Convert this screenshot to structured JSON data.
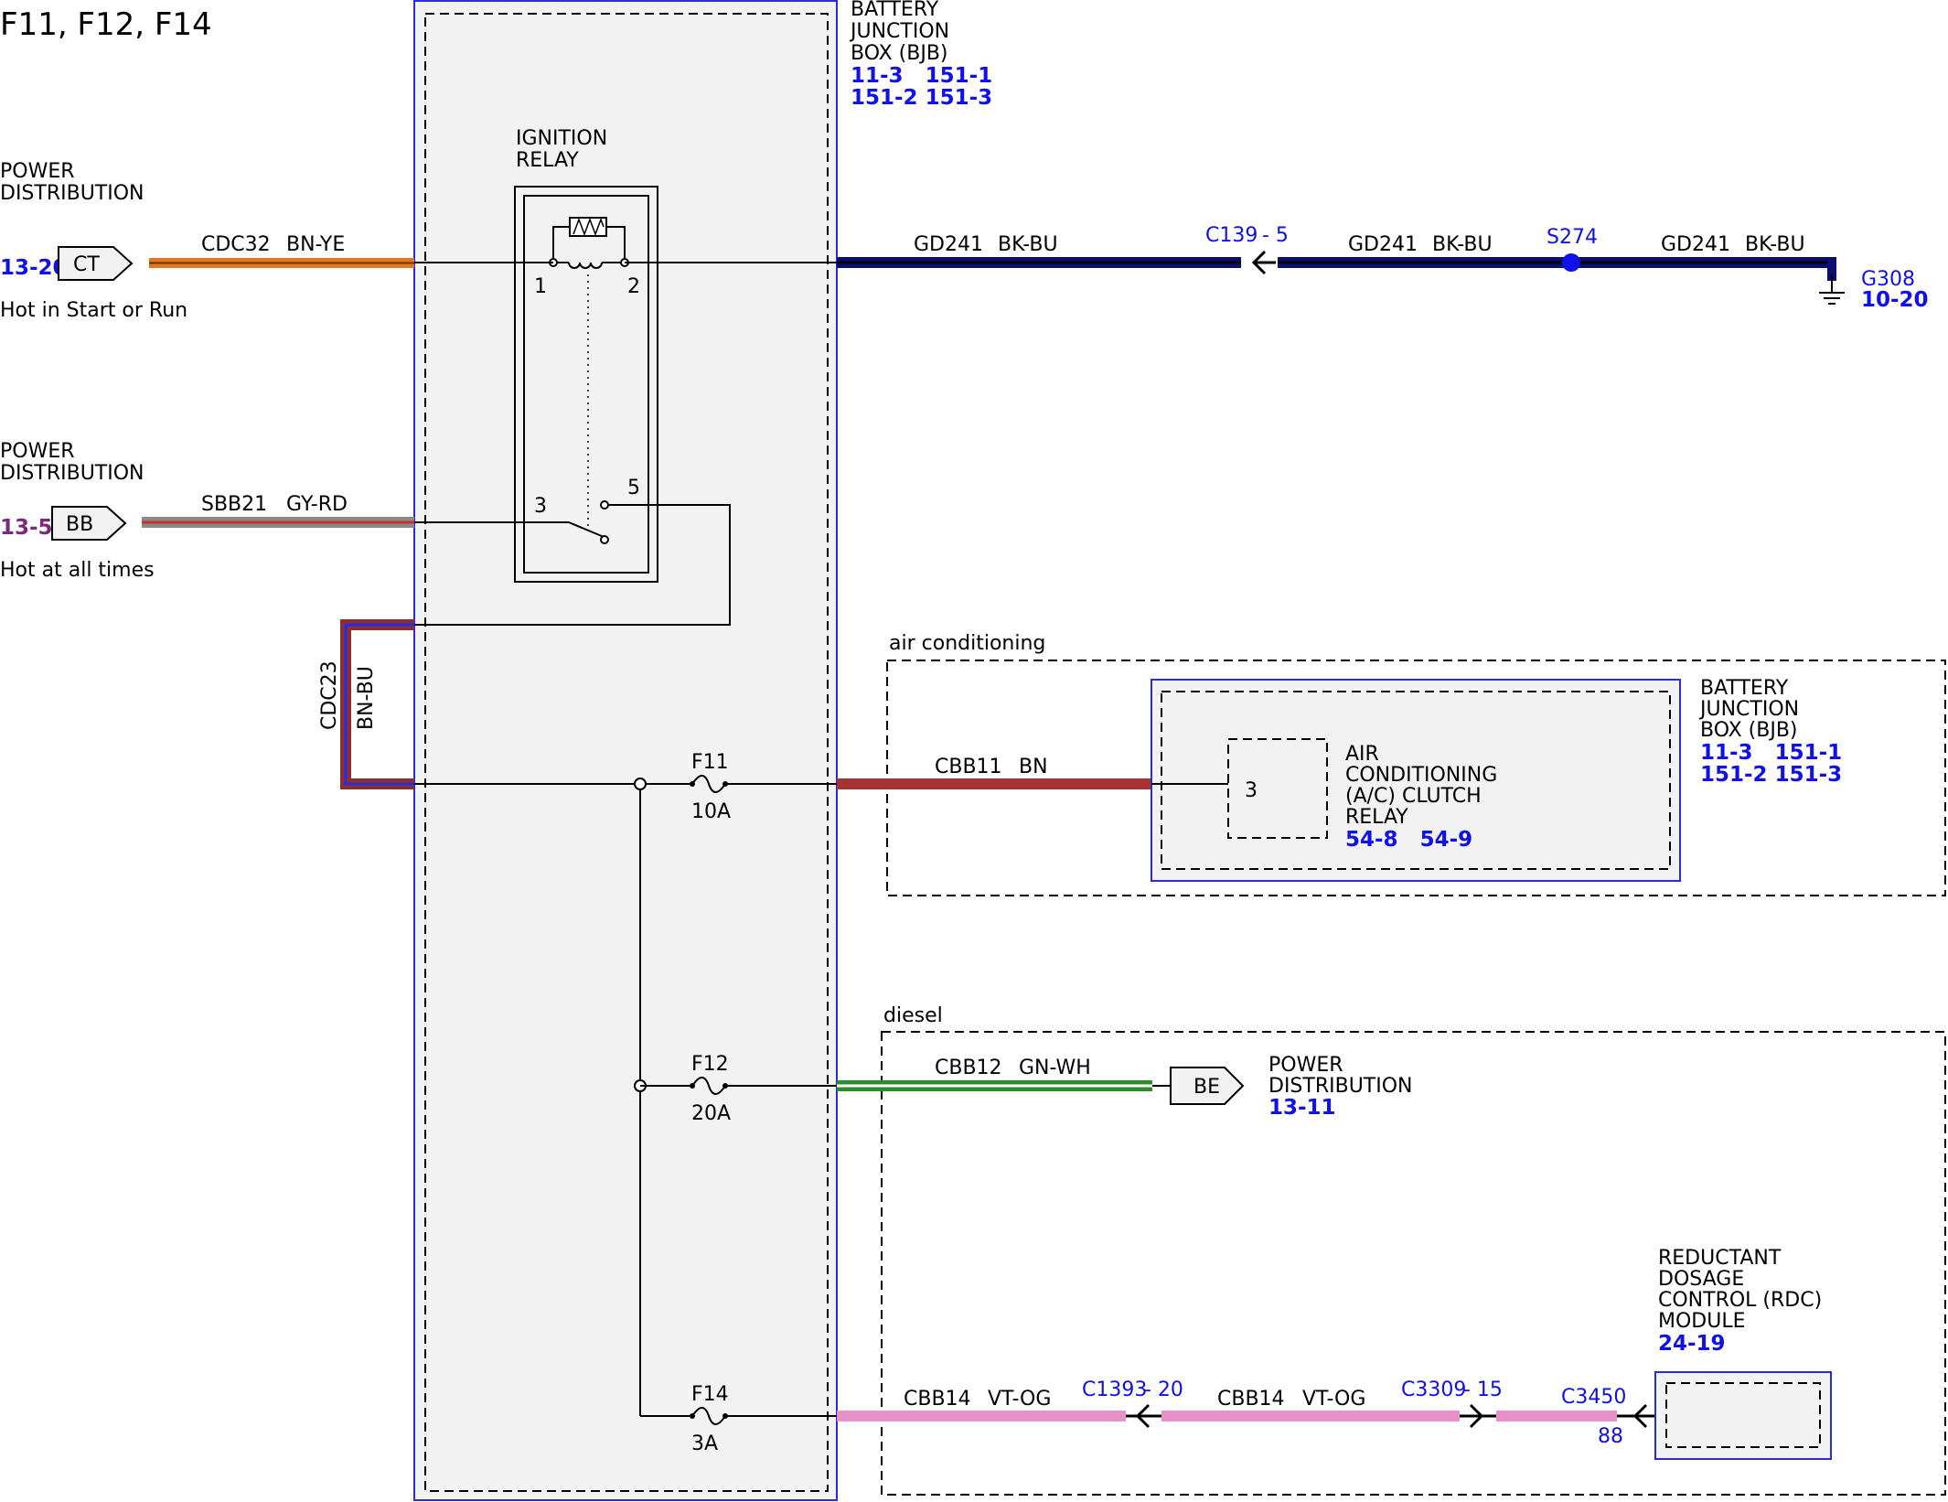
{
  "title": "F11, F12, F14",
  "bjb_main": {
    "name_lines": [
      "BATTERY",
      "JUNCTION",
      "BOX (BJB)"
    ],
    "ref_line1": "11-3   151-1",
    "ref_line2": "151-2 151-3"
  },
  "ignition_relay": {
    "label_lines": [
      "IGNITION",
      "RELAY"
    ],
    "pins": [
      "1",
      "2",
      "3",
      "5"
    ]
  },
  "inputs": [
    {
      "source_lines": [
        "POWER",
        "DISTRIBUTION"
      ],
      "ref": "13-20",
      "connector": "CT",
      "circuit": "CDC32",
      "color": "BN-YE",
      "note": "Hot in Start or Run"
    },
    {
      "source_lines": [
        "POWER",
        "DISTRIBUTION"
      ],
      "ref": "13-5",
      "connector": "BB",
      "circuit": "SBB21",
      "color": "GY-RD",
      "note": "Hot at all times"
    }
  ],
  "jumper": {
    "circuit": "CDC23",
    "color": "BN-BU"
  },
  "ground_path": {
    "seg1": {
      "circuit": "GD241",
      "color": "BK-BU"
    },
    "c139": {
      "name": "C139",
      "pin": "- 5"
    },
    "seg2": {
      "circuit": "GD241",
      "color": "BK-BU"
    },
    "splice": "S274",
    "seg3": {
      "circuit": "GD241",
      "color": "BK-BU"
    },
    "ground": "G308",
    "ground_ref": "10-20"
  },
  "fuses": [
    {
      "name": "F11",
      "rating": "10A"
    },
    {
      "name": "F12",
      "rating": "20A"
    },
    {
      "name": "F14",
      "rating": "3A"
    }
  ],
  "ac_option": {
    "label": "air conditioning",
    "wire": {
      "circuit": "CBB11",
      "color": "BN"
    },
    "pin": "3",
    "relay_lines": [
      "AIR",
      "CONDITIONING",
      "(A/C) CLUTCH",
      "RELAY"
    ],
    "relay_ref": "54-8   54-9",
    "bjb_lines": [
      "BATTERY",
      "JUNCTION",
      "BOX (BJB)"
    ],
    "bjb_ref1": "11-3   151-1",
    "bjb_ref2": "151-2 151-3"
  },
  "diesel_option": {
    "label": "diesel",
    "f12_wire": {
      "circuit": "CBB12",
      "color": "GN-WH"
    },
    "be_connector": "BE",
    "pd_lines": [
      "POWER",
      "DISTRIBUTION"
    ],
    "pd_ref": "13-11",
    "f14_wire1": {
      "circuit": "CBB14",
      "color": "VT-OG"
    },
    "c1393": {
      "name": "C1393",
      "pin": "- 20"
    },
    "f14_wire2": {
      "circuit": "CBB14",
      "color": "VT-OG"
    },
    "c3309": {
      "name": "C3309",
      "pin": "- 15"
    },
    "c3450": {
      "name": "C3450",
      "pin": "88"
    },
    "rdc_lines": [
      "REDUCTANT",
      "DOSAGE",
      "CONTROL (RDC)",
      "MODULE"
    ],
    "rdc_ref": "24-19"
  },
  "colors": {
    "link_blue": "#1010e8",
    "bn_ye": "#e07820",
    "gy_rd": "#8a8a8a",
    "bn_bu": "#8a2e2e",
    "bk_bu": "#0a1070",
    "bn": "#a83232",
    "gn_wh": "#2e8b2e",
    "vt_og": "#e890c8"
  }
}
